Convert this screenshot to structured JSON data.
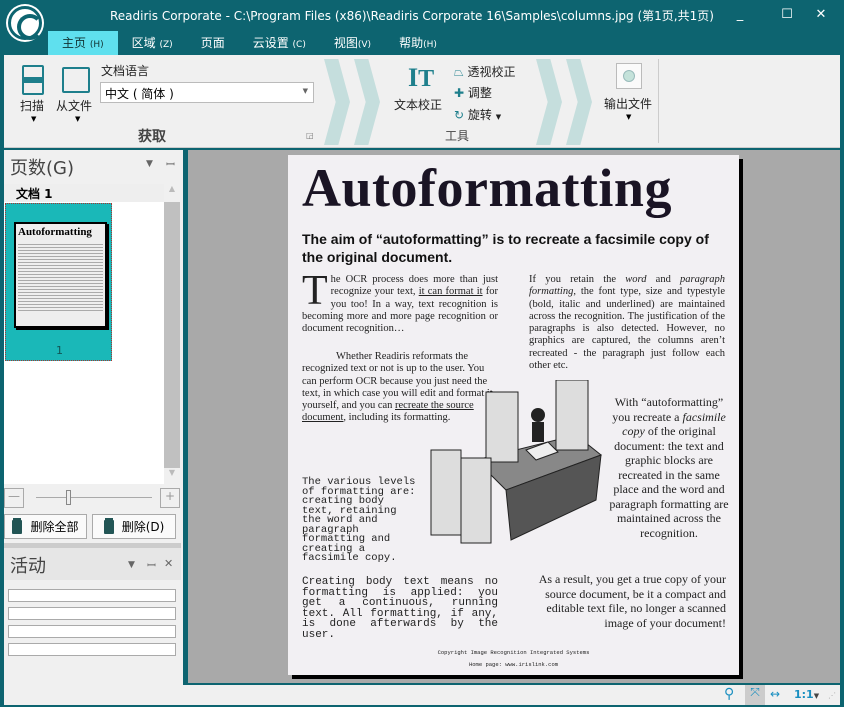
{
  "window": {
    "title": "Readiris Corporate - C:\\Program Files (x86)\\Readiris Corporate 16\\Samples\\columns.jpg (第1页,共1页)",
    "minimize": "_",
    "maximize": "☐",
    "close": "✕"
  },
  "tabs": [
    {
      "label": "主页",
      "key": "(H)"
    },
    {
      "label": "区域",
      "key": "(Z)"
    },
    {
      "label": "页面",
      "key": ""
    },
    {
      "label": "云设置",
      "key": "(C)"
    },
    {
      "label": "视图",
      "key": "(V)"
    },
    {
      "label": "帮助",
      "key": "(H)"
    }
  ],
  "ribbon": {
    "scan": "扫描",
    "from_file": "从文件",
    "doc_language_label": "文档语言",
    "doc_language_value": "中文 ( 简体 )",
    "group_acquire": "获取",
    "text_correct": "文本校正",
    "perspective": "透视校正",
    "adjust": "调整",
    "rotate": "旋转",
    "group_tools": "工具",
    "output_file": "输出文件"
  },
  "pages_panel": {
    "title": "页数(G)",
    "doc_label": "文档 1",
    "thumb_number": "1",
    "delete_all": "删除全部",
    "delete": "删除(D)",
    "zoom_slider_level": 0.3
  },
  "activity_panel": {
    "title": "活动"
  },
  "document": {
    "heading": "Autoformatting",
    "subheading": "The aim of “autoformatting” is to recreate a facsimile copy of the original document.",
    "p1_dropcap": "T",
    "p1_a": "he OCR process does more than just recognize your text, ",
    "p1_u": "it can format it",
    "p1_b": " for you too! In a way, text recognition is becoming more and more page recognition or document recognition…",
    "p2_a": "Whether Readiris reformats the recognized text or not is up to the user. You can perform OCR because you just need the text, in which case you will edit and format it yourself, and you can ",
    "p2_u": "recreate the source document",
    "p2_b": ", including its formatting.",
    "p3": "The various levels of formatting are: creating body text, retaining the word and paragraph formatting and creating a facsimile copy.",
    "p4": "Creating body text means no formatting is applied: you get a continuous, running text. All formatting, if any, is done afterwards by the user.",
    "r1_a": "If you retain the ",
    "r1_i1": "word",
    "r1_b": " and ",
    "r1_i2": "paragraph formatting",
    "r1_c": ", the font type, size and typestyle (bold, italic and underlined) are maintained across the recognition. The justification of the paragraphs is also detected. However, no graphics are captured, the columns aren’t recreated - the paragraph just follow each other etc.",
    "r2_a": "With “autoformatting” you recreate a ",
    "r2_i": "facsimile copy",
    "r2_b": " of the original document: the text and graphic blocks are recreated in the same place and the word and paragraph formatting are maintained across the recognition.",
    "r3": "As a result, you get a true copy of your source document, be it a compact and editable text file, no longer a scanned image of your document!",
    "footer1": "Copyright Image Recognition Integrated Systems",
    "footer2": "Home page: www.irislink.com"
  },
  "statusbar": {
    "zoom_ratio": "1:1"
  },
  "colors": {
    "chrome": "#0d6470",
    "active_tab": "#5fe0ee",
    "thumb_selected": "#1ab8b8"
  }
}
